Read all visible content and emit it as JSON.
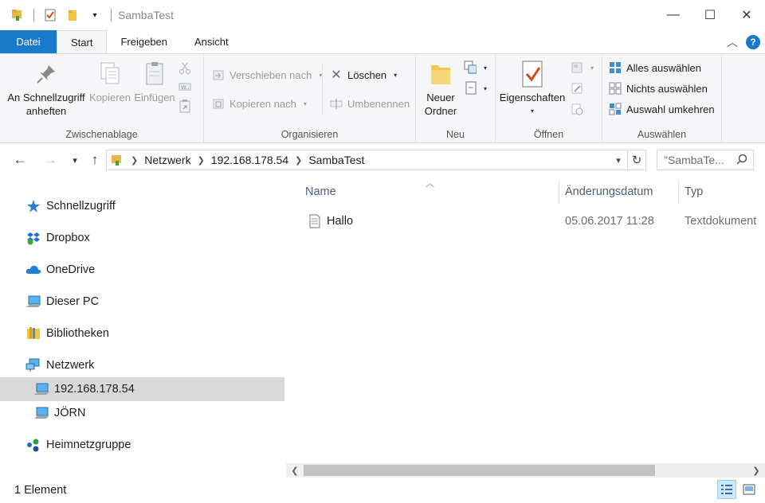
{
  "window": {
    "title": "SambaTest",
    "minimize_glyph": "—",
    "maximize_glyph": "☐",
    "close_glyph": "✕"
  },
  "tabs": {
    "file": "Datei",
    "start": "Start",
    "share": "Freigeben",
    "view": "Ansicht",
    "collapse_glyph": "︿",
    "help": "?"
  },
  "ribbon": {
    "clipboard": {
      "label": "Zwischenablage",
      "pin_line1": "An Schnellzugriff",
      "pin_line2": "anheften",
      "copy": "Kopieren",
      "paste": "Einfügen"
    },
    "organize": {
      "label": "Organisieren",
      "move_to": "Verschieben nach",
      "copy_to": "Kopieren nach",
      "delete": "Löschen",
      "rename": "Umbenennen"
    },
    "new": {
      "label": "Neu",
      "new_folder_line1": "Neuer",
      "new_folder_line2": "Ordner"
    },
    "open": {
      "label": "Öffnen",
      "properties": "Eigenschaften"
    },
    "select": {
      "label": "Auswählen",
      "select_all": "Alles auswählen",
      "select_none": "Nichts auswählen",
      "invert": "Auswahl umkehren"
    }
  },
  "address": {
    "crumbs": [
      "Netzwerk",
      "192.168.178.54",
      "SambaTest"
    ],
    "search_placeholder": "\"SambaTe..."
  },
  "nav": {
    "items": [
      {
        "label": "Schnellzugriff",
        "icon": "star-icon"
      },
      {
        "label": "Dropbox",
        "icon": "dropbox-icon"
      },
      {
        "label": "OneDrive",
        "icon": "cloud-icon"
      },
      {
        "label": "Dieser PC",
        "icon": "computer-icon"
      },
      {
        "label": "Bibliotheken",
        "icon": "library-icon"
      },
      {
        "label": "Netzwerk",
        "icon": "network-icon"
      },
      {
        "label": "192.168.178.54",
        "icon": "computer-icon",
        "selected": true
      },
      {
        "label": "JÖRN",
        "icon": "computer-icon"
      },
      {
        "label": "Heimnetzgruppe",
        "icon": "homegroup-icon"
      }
    ]
  },
  "columns": {
    "name": "Name",
    "date": "Änderungsdatum",
    "type": "Typ"
  },
  "files": [
    {
      "name": "Hallo",
      "date": "05.06.2017 11:28",
      "type": "Textdokument"
    }
  ],
  "status": {
    "count": "1 Element"
  },
  "colors": {
    "accent": "#1979ca",
    "ribbon_bg": "#f5f6f7",
    "selection": "#d9d9d9",
    "header_text": "#4c607a"
  }
}
